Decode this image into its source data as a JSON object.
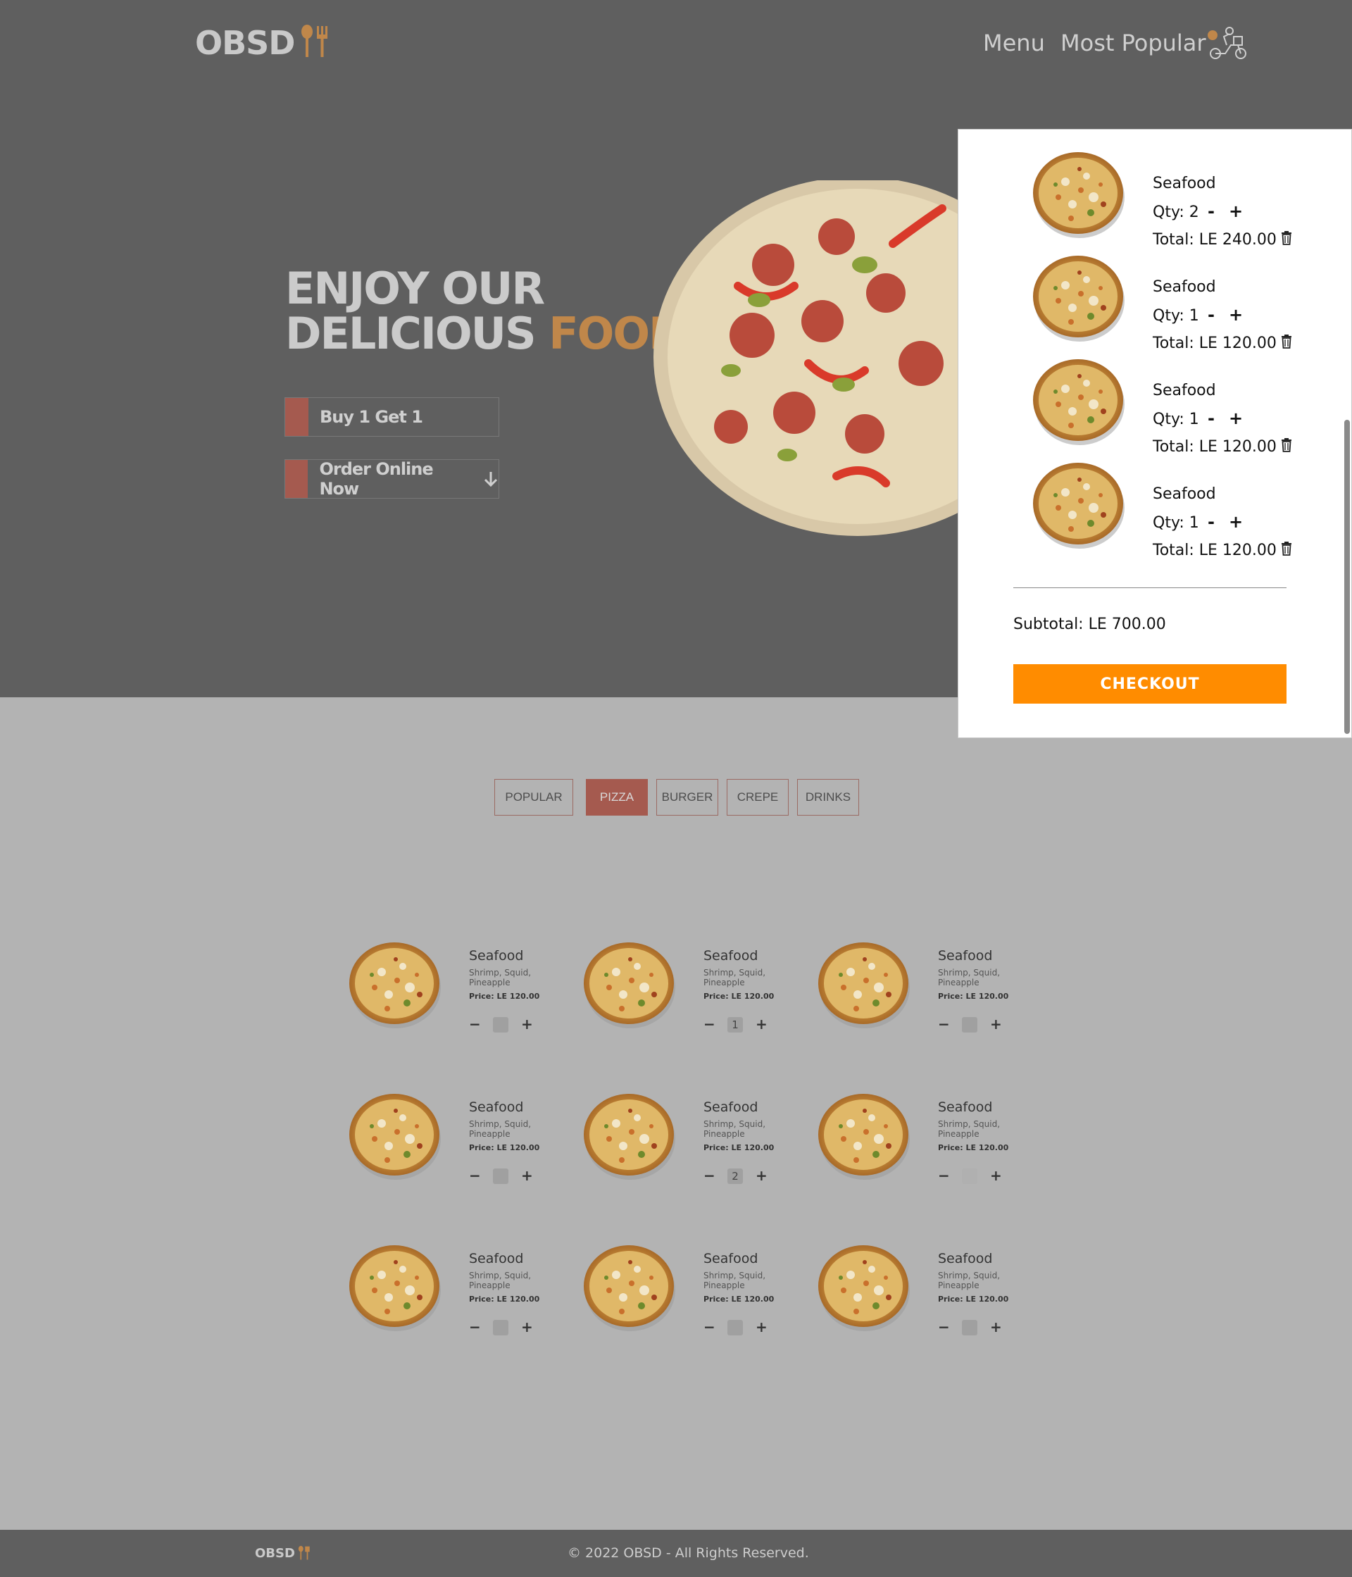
{
  "header": {
    "logo": "OBSD",
    "nav": [
      "Menu",
      "Most Popular"
    ]
  },
  "hero": {
    "title_line1": "ENJOY OUR",
    "title_line2_plain": "DELICIOUS",
    "title_line2_accent": "FOOD",
    "buttons": [
      "Buy 1 Get 1",
      "Order Online Now"
    ]
  },
  "tabs": [
    "POPULAR",
    "PIZZA",
    "BURGER",
    "CREPE",
    "DRINKS"
  ],
  "active_tab": "PIZZA",
  "menu": {
    "items": [
      {
        "name": "Seafood",
        "desc": "Shrimp, Squid, Pineapple",
        "price": "Price: LE 120.00",
        "qty": ""
      },
      {
        "name": "Seafood",
        "desc": "Shrimp, Squid, Pineapple",
        "price": "Price: LE 120.00",
        "qty": "1"
      },
      {
        "name": "Seafood",
        "desc": "Shrimp, Squid, Pineapple",
        "price": "Price: LE 120.00",
        "qty": ""
      },
      {
        "name": "Seafood",
        "desc": "Shrimp, Squid, Pineapple",
        "price": "Price: LE 120.00",
        "qty": ""
      },
      {
        "name": "Seafood",
        "desc": "Shrimp, Squid, Pineapple",
        "price": "Price: LE 120.00",
        "qty": "2"
      },
      {
        "name": "Seafood",
        "desc": "Shrimp, Squid, Pineapple",
        "price": "Price: LE 120.00",
        "qty": ""
      },
      {
        "name": "Seafood",
        "desc": "Shrimp, Squid, Pineapple",
        "price": "Price: LE 120.00",
        "qty": ""
      },
      {
        "name": "Seafood",
        "desc": "Shrimp, Squid, Pineapple",
        "price": "Price: LE 120.00",
        "qty": ""
      },
      {
        "name": "Seafood",
        "desc": "Shrimp, Squid, Pineapple",
        "price": "Price: LE 120.00",
        "qty": ""
      }
    ],
    "minus": "−",
    "plus": "+"
  },
  "cart": {
    "items": [
      {
        "name": "Seafood",
        "qty": "Qty: 2",
        "total": "Total: LE 240.00"
      },
      {
        "name": "Seafood",
        "qty": "Qty: 1",
        "total": "Total: LE 120.00"
      },
      {
        "name": "Seafood",
        "qty": "Qty: 1",
        "total": "Total: LE 120.00"
      },
      {
        "name": "Seafood",
        "qty": "Qty: 1",
        "total": "Total: LE 120.00"
      }
    ],
    "minus": "-",
    "plus": "+",
    "subtotal": "Subtotal:  LE 700.00",
    "checkout": "CHECKOUT"
  },
  "footer": {
    "logo": "OBSD",
    "copyright": "© 2022 OBSD - All Rights Reserved."
  },
  "icons": {
    "logo": "fork-spoon-icon",
    "cart": "delivery-scooter-icon",
    "arrow": "arrow-down-icon",
    "trash": "trash-icon"
  },
  "colors": {
    "accent": "#c0874a",
    "tab_active": "#a55a4f",
    "checkout": "#ff8c00"
  }
}
